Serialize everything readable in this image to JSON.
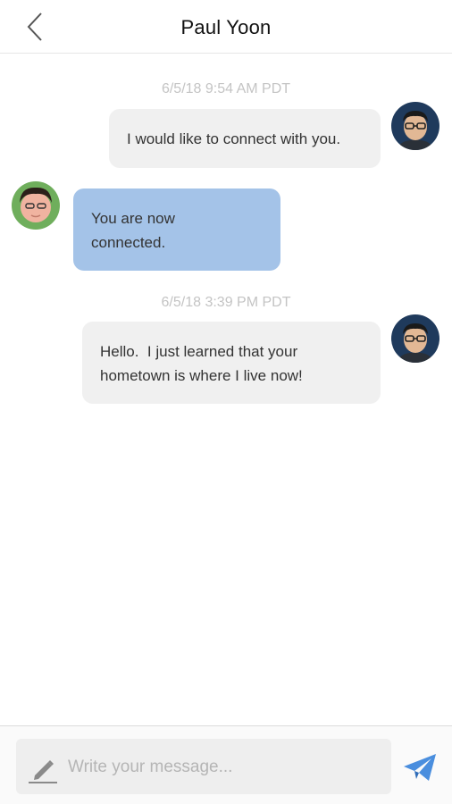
{
  "header": {
    "title": "Paul Yoon",
    "back_icon": "chevron-left-icon"
  },
  "messages": [
    {
      "timestamp": "6/5/18 9:54 AM PDT"
    },
    {
      "direction": "outgoing",
      "text": "I would like to connect with you."
    },
    {
      "direction": "incoming",
      "lines": [
        "You are now",
        "connected."
      ]
    },
    {
      "timestamp": "6/5/18 3:39 PM PDT"
    },
    {
      "direction": "outgoing",
      "lines": [
        "Hello.  I just learned that your",
        "hometown is where I live now!"
      ]
    }
  ],
  "composer": {
    "placeholder": "Write your message...",
    "value": "",
    "pencil_icon": "pencil-icon",
    "send_icon": "paper-plane-icon"
  },
  "colors": {
    "incoming_bubble": "#a4c3e8",
    "outgoing_bubble": "#f0f0f0",
    "send_icon": "#4a8ede",
    "timestamp": "#c4c4c4"
  }
}
